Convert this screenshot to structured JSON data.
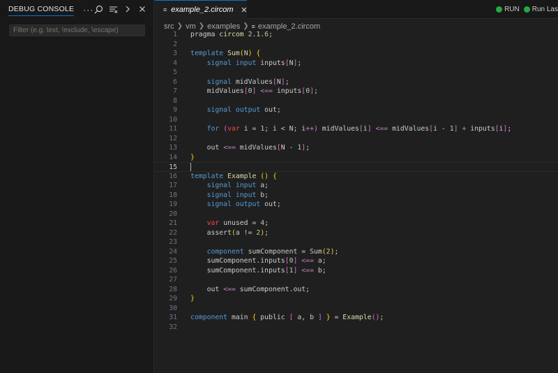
{
  "panel": {
    "title": "DEBUG CONSOLE",
    "more": "···",
    "filter_placeholder": "Filter (e.g. text, !exclude, \\escape)"
  },
  "tab": {
    "filename": "example_2.circom",
    "file_icon": "≡"
  },
  "run_buttons": {
    "run": "RUN",
    "run_last": "Run Las"
  },
  "breadcrumb": [
    "src",
    "vm",
    "examples",
    "example_2.circom"
  ],
  "code": {
    "current_line": 15,
    "lines": [
      {
        "n": "1"
      },
      {
        "n": "2"
      },
      {
        "n": "3"
      },
      {
        "n": "4"
      },
      {
        "n": "5"
      },
      {
        "n": "6"
      },
      {
        "n": "7"
      },
      {
        "n": "8"
      },
      {
        "n": "9"
      },
      {
        "n": "10"
      },
      {
        "n": "11"
      },
      {
        "n": "12"
      },
      {
        "n": "13"
      },
      {
        "n": "14"
      },
      {
        "n": "15"
      },
      {
        "n": "16"
      },
      {
        "n": "17"
      },
      {
        "n": "18"
      },
      {
        "n": "19"
      },
      {
        "n": "20"
      },
      {
        "n": "21"
      },
      {
        "n": "22"
      },
      {
        "n": "23"
      },
      {
        "n": "24"
      },
      {
        "n": "25"
      },
      {
        "n": "26"
      },
      {
        "n": "27"
      },
      {
        "n": "28"
      },
      {
        "n": "29"
      },
      {
        "n": "30"
      },
      {
        "n": "31"
      },
      {
        "n": "32"
      }
    ],
    "tokens": {
      "l1": [
        "pragma ",
        "circom",
        " 2.1.6",
        ";"
      ],
      "l3": [
        "template",
        " Sum",
        "(",
        "N",
        ")",
        " {"
      ],
      "l4": [
        "    ",
        "signal",
        " ",
        "input",
        " inputs",
        "[",
        "N",
        "]",
        ";"
      ],
      "l6": [
        "    ",
        "signal",
        " midValues",
        "[",
        "N",
        "]",
        ";"
      ],
      "l7": [
        "    ",
        "midValues",
        "[",
        "0",
        "]",
        " <== ",
        "inputs",
        "[",
        "0",
        "]",
        ";"
      ],
      "l9": [
        "    ",
        "signal",
        " ",
        "output",
        " out;"
      ],
      "l11": [
        "    ",
        "for",
        " ",
        "(",
        "var",
        " i = ",
        "1",
        "; i < N; i",
        "++",
        ")",
        " midValues",
        "[",
        "i",
        "]",
        " <== ",
        "midValues",
        "[",
        "i - ",
        "1",
        "]",
        " + ",
        "inputs",
        "[",
        "i",
        "]",
        ";"
      ],
      "l13": [
        "    ",
        "out ",
        "<==",
        " midValues",
        "[",
        "N - ",
        "1",
        "]",
        ";"
      ],
      "l14": [
        "}"
      ],
      "l16": [
        "template",
        " Example ",
        "()",
        " {"
      ],
      "l17": [
        "    ",
        "signal",
        " ",
        "input",
        " a;"
      ],
      "l18": [
        "    ",
        "signal",
        " ",
        "input",
        " b;"
      ],
      "l19": [
        "    ",
        "signal",
        " ",
        "output",
        " out;"
      ],
      "l21": [
        "    ",
        "var",
        " unused = ",
        "4",
        ";"
      ],
      "l22": [
        "    ",
        "assert",
        "(",
        "a != ",
        "2",
        ")",
        ";"
      ],
      "l24": [
        "    ",
        "component",
        " sumComponent = ",
        "Sum",
        "(",
        "2",
        ")",
        ";"
      ],
      "l25": [
        "    ",
        "sumComponent.inputs",
        "[",
        "0",
        "]",
        " <== ",
        "a;"
      ],
      "l26": [
        "    ",
        "sumComponent.inputs",
        "[",
        "1",
        "]",
        " <== ",
        "b;"
      ],
      "l28": [
        "    ",
        "out ",
        "<==",
        " sumComponent.out;"
      ],
      "l29": [
        "}"
      ],
      "l31": [
        "component",
        " main ",
        "{",
        " public ",
        "[",
        " a, b ",
        "]",
        " ",
        "}",
        " = ",
        "Example",
        "()",
        ";"
      ]
    }
  },
  "colors": {
    "accent": "#0078d4",
    "run_green": "#28a745",
    "keyword": "#569cd6",
    "signal": "#4fc1ff",
    "number": "#b5cea8",
    "bracket_gold": "#ffd700",
    "bracket_pink": "#da70d6",
    "operator": "#c586c0",
    "var_red": "#f44747"
  }
}
